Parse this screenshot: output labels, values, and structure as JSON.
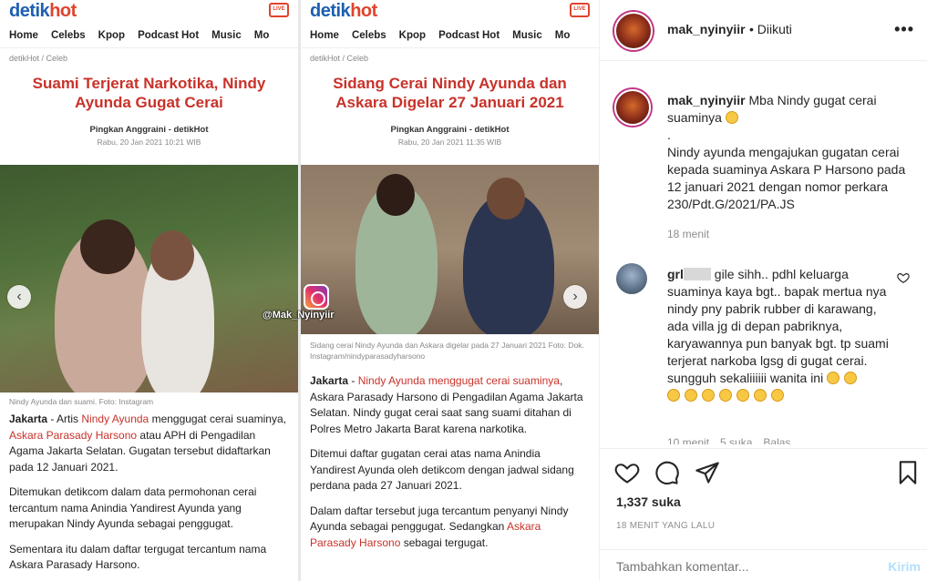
{
  "left_article": {
    "logo_main": "detik",
    "logo_accent": "hot",
    "live_badge": "LIVE",
    "nav": [
      "Home",
      "Celebs",
      "Kpop",
      "Podcast Hot",
      "Music",
      "Mo"
    ],
    "breadcrumb": "detikHot / Celeb",
    "title": "Suami Terjerat Narkotika, Nindy Ayunda Gugat Cerai",
    "author": "Pingkan Anggraini - detikHot",
    "date": "Rabu, 20 Jan 2021 10:21 WIB",
    "watermark": "@Mak_Nyinyiir",
    "photo_caption": "Nindy Ayunda dan suami. Foto: Instagram",
    "p1_city": "Jakarta",
    "p1_a": " - Artis ",
    "p1_link1": "Nindy Ayunda",
    "p1_b": " menggugat cerai suaminya, ",
    "p1_link2": "Askara Parasady Harsono",
    "p1_c": " atau APH di Pengadilan Agama Jakarta Selatan. Gugatan tersebut didaftarkan pada 12 Januari 2021.",
    "p2": "Ditemukan detikcom dalam data permohonan cerai tercantum nama Anindia Yandirest Ayunda yang merupakan Nindy Ayunda sebagai penggugat.",
    "p3": "Sementara itu dalam daftar tergugat tercantum nama Askara Parasady Harsono."
  },
  "right_article": {
    "logo_main": "detik",
    "logo_accent": "hot",
    "live_badge": "LIVE",
    "nav": [
      "Home",
      "Celebs",
      "Kpop",
      "Podcast Hot",
      "Music",
      "Mo"
    ],
    "breadcrumb": "detikHot / Celeb",
    "title": "Sidang Cerai Nindy Ayunda dan Askara Digelar 27 Januari 2021",
    "author": "Pingkan Anggraini - detikHot",
    "date": "Rabu, 20 Jan 2021 11:35 WIB",
    "photo_caption": "Sidang cerai Nindy Ayunda dan Askara digelar pada 27 Januari 2021 Foto: Dok. Instagram/nindyparasadyharsono",
    "p1_city": "Jakarta",
    "p1_a": " - ",
    "p1_link1": "Nindy Ayunda menggugat cerai suaminya",
    "p1_b": ", Askara Parasady Harsono di Pengadilan Agama Jakarta Selatan. Nindy gugat cerai saat sang suami ditahan di Polres Metro Jakarta Barat karena narkotika.",
    "p2": "Ditemui daftar gugatan cerai atas nama Anindia Yandirest Ayunda oleh detikcom dengan jadwal sidang perdana pada 27 Januari 2021.",
    "p3_a": "Dalam daftar tersebut juga tercantum penyanyi Nindy Ayunda sebagai penggugat. Sedangkan ",
    "p3_link": "Askara Parasady Harsono",
    "p3_b": " sebagai tergugat."
  },
  "post": {
    "username": "mak_nyinyiir",
    "follow_status": "• Diikuti",
    "more_icon": "more-horizontal-icon",
    "caption_user": "mak_nyinyiir",
    "caption_line1": " Mba Nindy gugat cerai suaminya ",
    "caption_dot": ".",
    "caption_body": "Nindy ayunda mengajukan gugatan cerai kepada suaminya Askara P Harsono pada 12 januari 2021 dengan nomor perkara 230/Pdt.G/2021/PA.JS",
    "caption_time": "18 menit",
    "comment_user": "grl",
    "comment_text": " gile sihh.. pdhl keluarga suaminya kaya bgt.. bapak mertua nya nindy pny pabrik rubber di karawang, ada villa jg di depan pabriknya, karyawannya pun banyak bgt. tp suami terjerat narkoba lgsg di gugat cerai. sungguh sekaliiiiii wanita ini ",
    "comment_time": "10 menit",
    "comment_likes": "5 suka",
    "comment_reply": "Balas",
    "likes": "1,337 suka",
    "posted_ago": "18 MENIT YANG LALU",
    "comment_placeholder": "Tambahkan komentar...",
    "post_button": "Kirim"
  }
}
